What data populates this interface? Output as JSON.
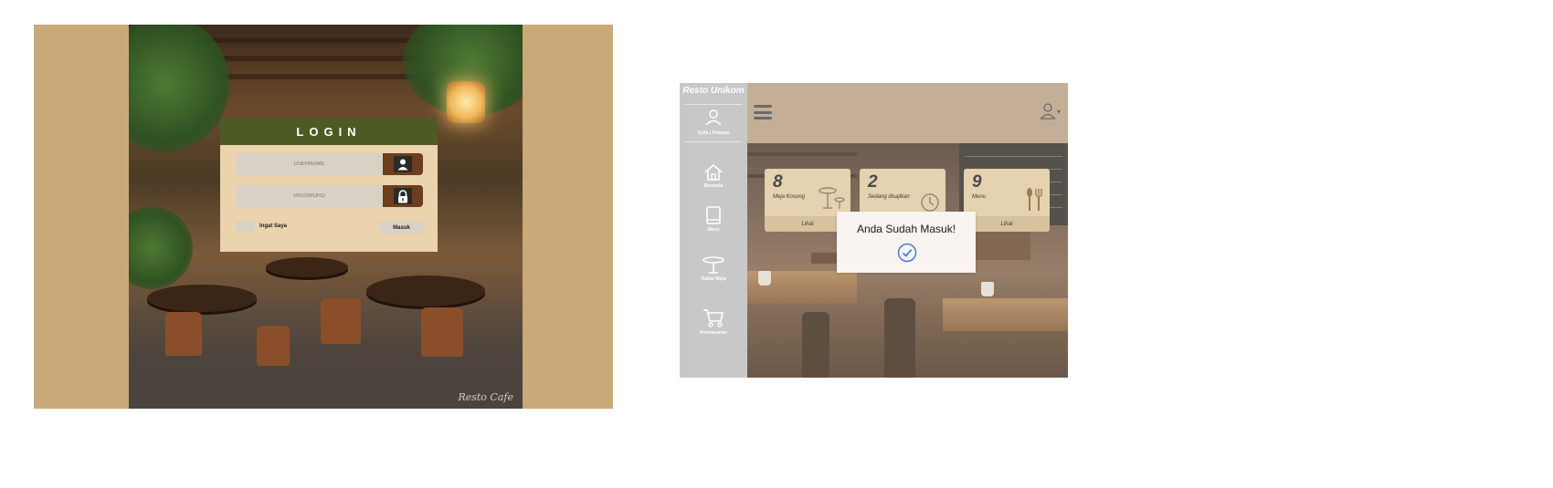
{
  "login": {
    "title": "LOGIN",
    "username_placeholder": "USERNAME",
    "password_placeholder": "PASSWORD",
    "remember_label": "Ingat Saya",
    "submit_label": "Masuk",
    "signature": "Resto Cafe",
    "colors": {
      "frame": "#c9a879",
      "header": "#4e5a24",
      "card": "#ebd3ad",
      "icon_box": "#6b3e1c"
    }
  },
  "dashboard": {
    "brand": "Resto Unikom",
    "user_tabs": "Sylfa  |  Pelayan",
    "nav": [
      {
        "label": "Beranda",
        "icon": "home-icon"
      },
      {
        "label": "Menu",
        "icon": "book-icon"
      },
      {
        "label": "Daftar Meja",
        "icon": "table-icon"
      },
      {
        "label": "Permesanan",
        "icon": "cart-icon"
      }
    ],
    "cards": [
      {
        "number": "8",
        "label": "Meja Kosong",
        "footer": "Lihat",
        "icon": "table-icon"
      },
      {
        "number": "2",
        "label": "Sedang disajikan",
        "footer": "",
        "icon": "clock-icon"
      },
      {
        "number": "9",
        "label": "Menu",
        "footer": "Lihat",
        "icon": "cutlery-icon"
      }
    ],
    "toast": {
      "message": "Anda Sudah Masuk!",
      "icon": "check-circle-icon"
    },
    "colors": {
      "sidebar": "#c8c8c8",
      "topbar": "#c4af96",
      "card": "#e4d2b0",
      "check": "#4a7bd8"
    }
  }
}
